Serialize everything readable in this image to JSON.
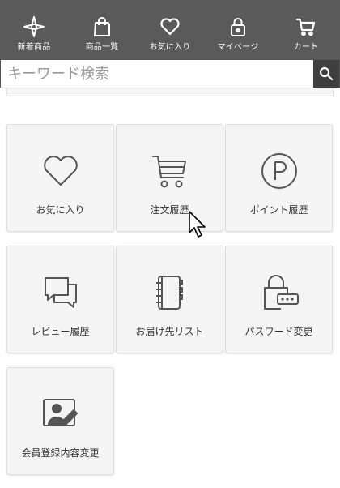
{
  "nav": {
    "items": [
      {
        "label": "新着商品",
        "icon": "sparkle-icon"
      },
      {
        "label": "商品一覧",
        "icon": "shopping-bag-icon"
      },
      {
        "label": "お気に入り",
        "icon": "heart-icon"
      },
      {
        "label": "マイページ",
        "icon": "lock-icon"
      },
      {
        "label": "カート",
        "icon": "cart-icon"
      }
    ]
  },
  "search": {
    "placeholder": "キーワード検索",
    "icon": "search-icon"
  },
  "menu": {
    "tiles": [
      {
        "label": "お気に入り",
        "icon": "heart-icon"
      },
      {
        "label": "注文履歴",
        "icon": "cart-icon"
      },
      {
        "label": "ポイント履歴",
        "icon": "point-icon"
      },
      {
        "label": "レビュー履歴",
        "icon": "speech-bubbles-icon"
      },
      {
        "label": "お届け先リスト",
        "icon": "address-book-icon"
      },
      {
        "label": "パスワード変更",
        "icon": "password-lock-icon"
      },
      {
        "label": "会員登録内容変更",
        "icon": "profile-edit-icon"
      }
    ]
  },
  "colors": {
    "nav_bg": "#5a5a5a",
    "search_button_bg": "#3f3f3f",
    "tile_bg": "#f5f5f5",
    "icon_stroke": "#555555"
  }
}
